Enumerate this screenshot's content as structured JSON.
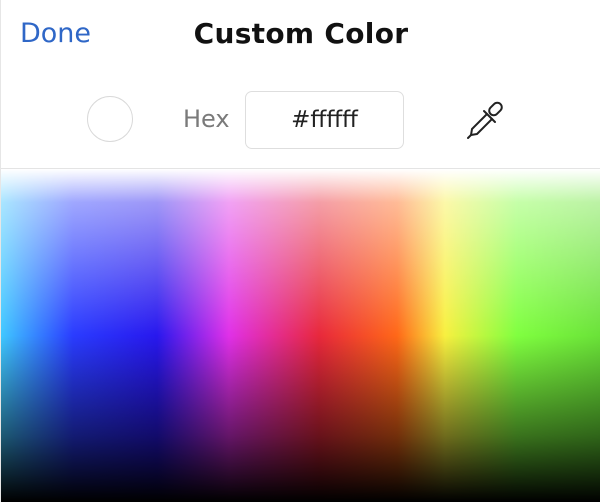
{
  "header": {
    "done_label": "Done",
    "title": "Custom Color"
  },
  "toolbar": {
    "selected_color": "#ffffff",
    "hex_label": "Hex",
    "hex_value": "#ffffff",
    "eyedropper_icon": "eyedropper-icon"
  },
  "colors": {
    "accent": "#2f67c7"
  }
}
